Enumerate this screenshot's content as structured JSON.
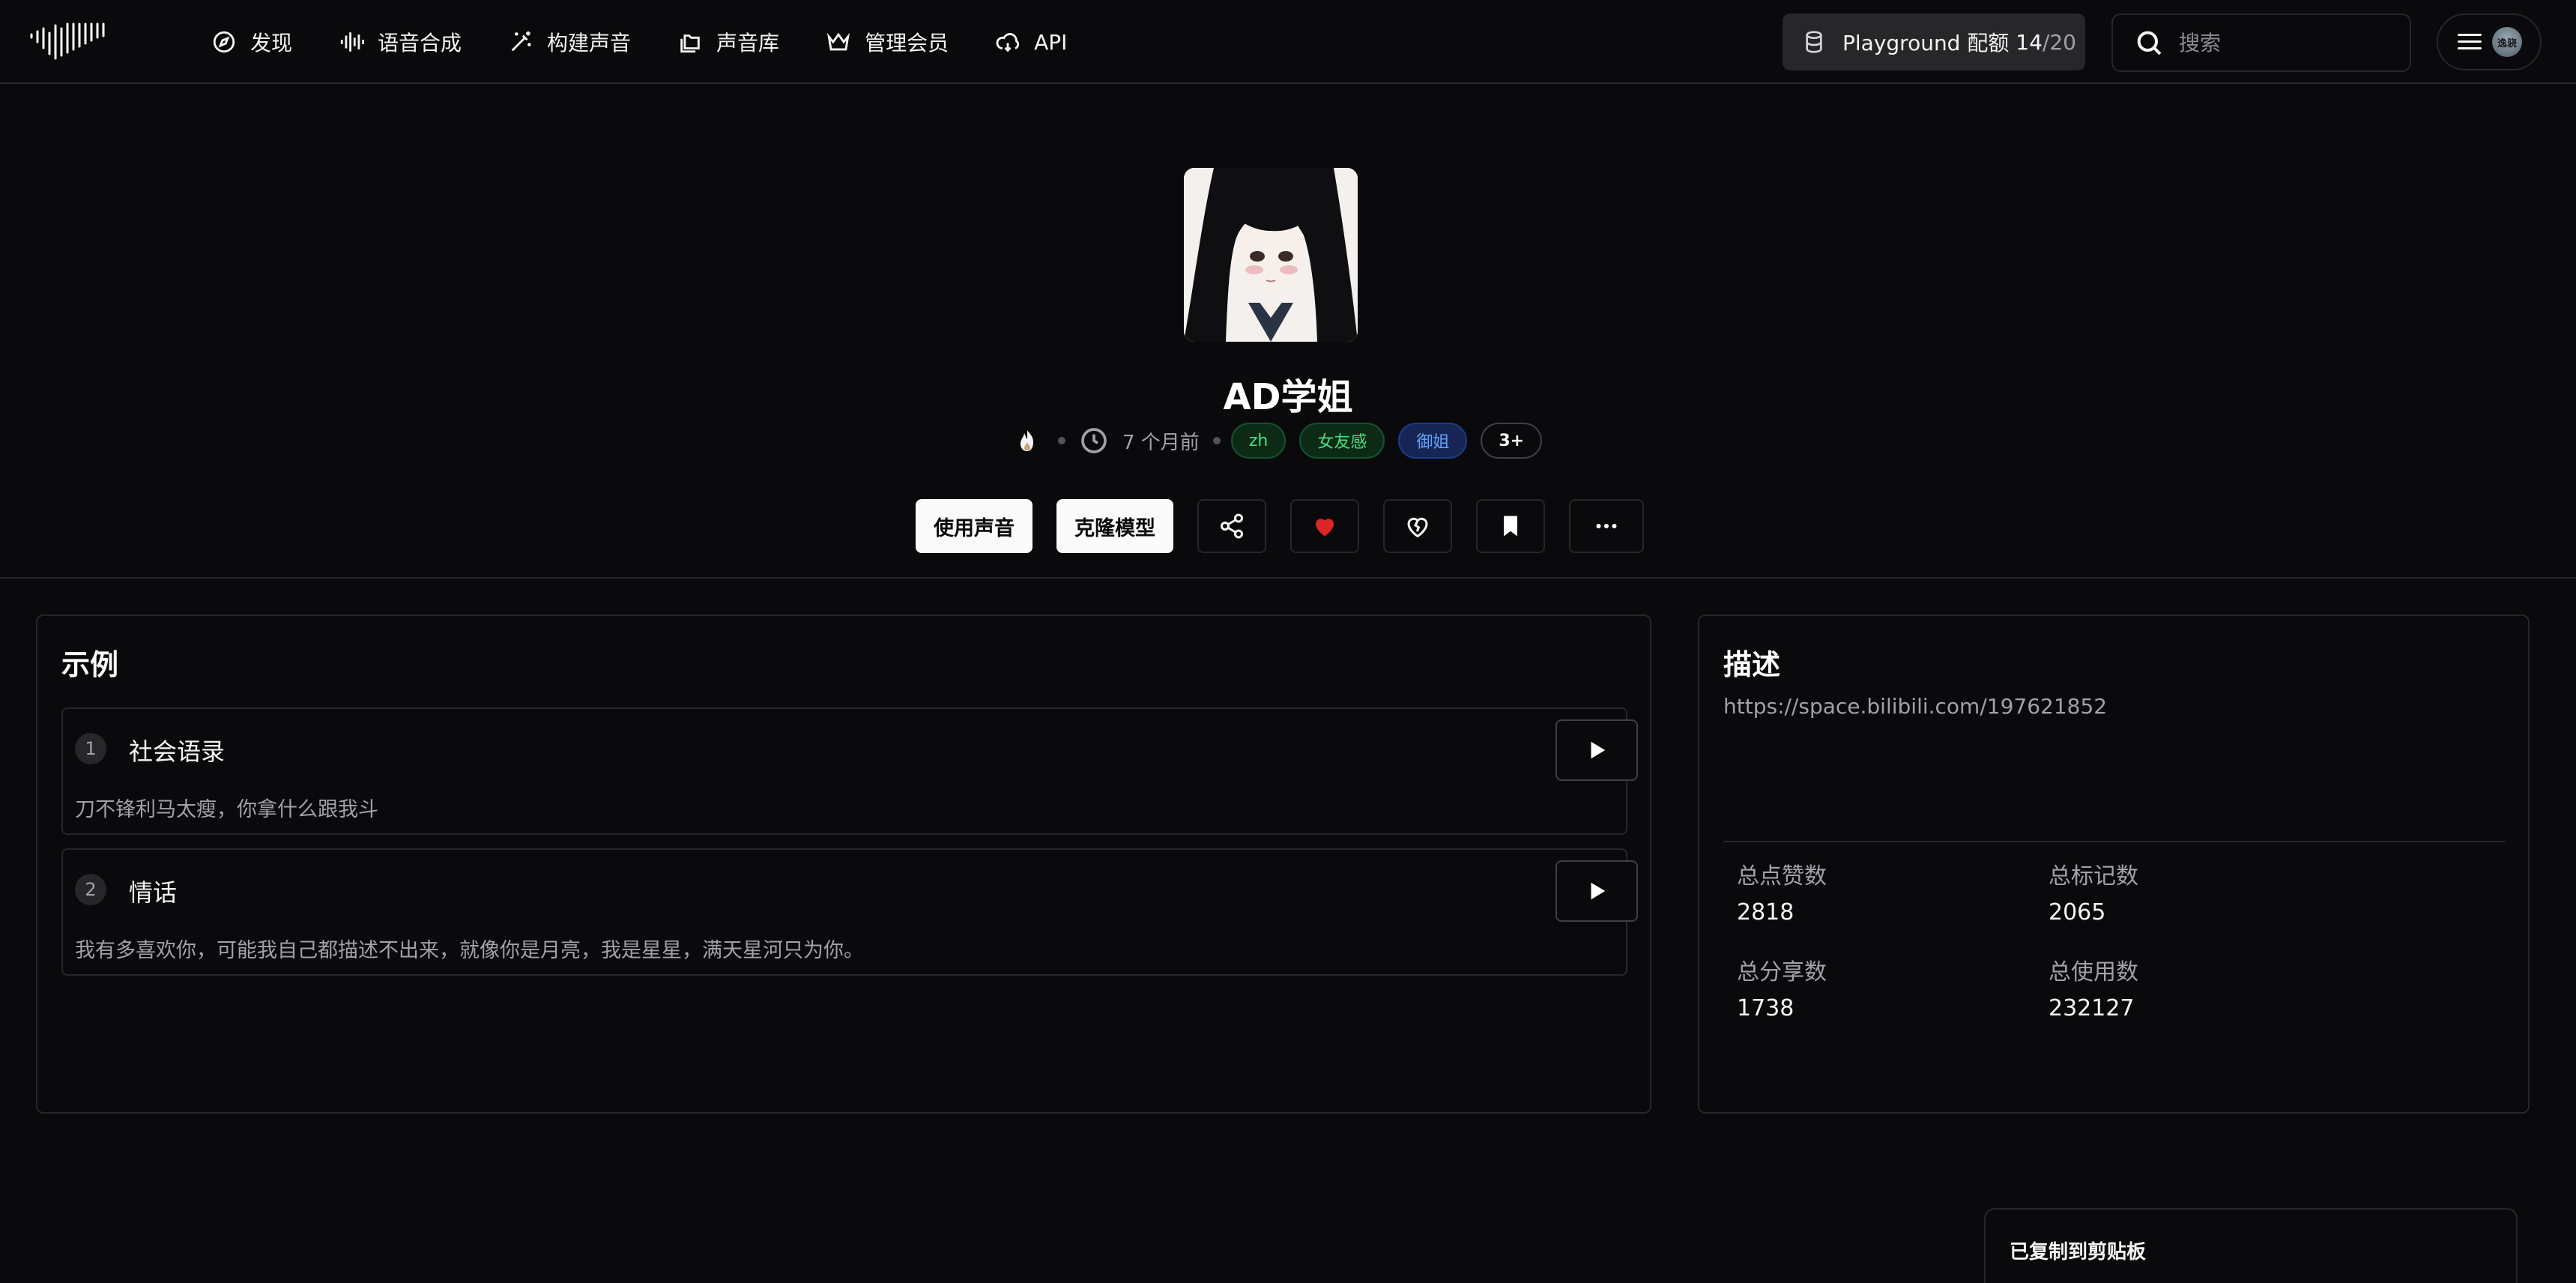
{
  "header": {
    "logo_icon": "waveform-logo",
    "nav": [
      {
        "label": "发现",
        "icon": "compass-icon"
      },
      {
        "label": "语音合成",
        "icon": "audio-lines-icon"
      },
      {
        "label": "构建声音",
        "icon": "magic-wand-icon"
      },
      {
        "label": "声音库",
        "icon": "folders-icon"
      },
      {
        "label": "管理会员",
        "icon": "crown-icon"
      },
      {
        "label": "API",
        "icon": "cloud-icon"
      }
    ],
    "quota": {
      "label": "Playground 配额",
      "used": "14",
      "sep": "/",
      "max": "20"
    },
    "search": {
      "placeholder": "搜索"
    },
    "avatar_text": "逸骁"
  },
  "voice": {
    "title": "AD学姐",
    "time_ago": "7 个月前",
    "tags": [
      "zh",
      "女友感",
      "御姐"
    ],
    "more_tags": "3+",
    "actions": {
      "use": "使用声音",
      "clone": "克隆模型"
    },
    "icons": [
      "share-icon",
      "heart-icon",
      "heart-crack-icon",
      "bookmark-icon",
      "more-icon"
    ],
    "liked_color": "#dc2626"
  },
  "examples": {
    "title": "示例",
    "items": [
      {
        "num": "1",
        "title": "社会语录",
        "text": "刀不锋利马太瘦，你拿什么跟我斗"
      },
      {
        "num": "2",
        "title": "情话",
        "text": "我有多喜欢你，可能我自己都描述不出来，就像你是月亮，我是星星，满天星河只为你。"
      }
    ]
  },
  "description": {
    "title": "描述",
    "link": "https://space.bilibili.com/197621852",
    "stats": [
      {
        "label": "总点赞数",
        "value": "2818"
      },
      {
        "label": "总标记数",
        "value": "2065"
      },
      {
        "label": "总分享数",
        "value": "1738"
      },
      {
        "label": "总使用数",
        "value": "232127"
      }
    ]
  },
  "toast": {
    "message": "已复制到剪贴板"
  }
}
